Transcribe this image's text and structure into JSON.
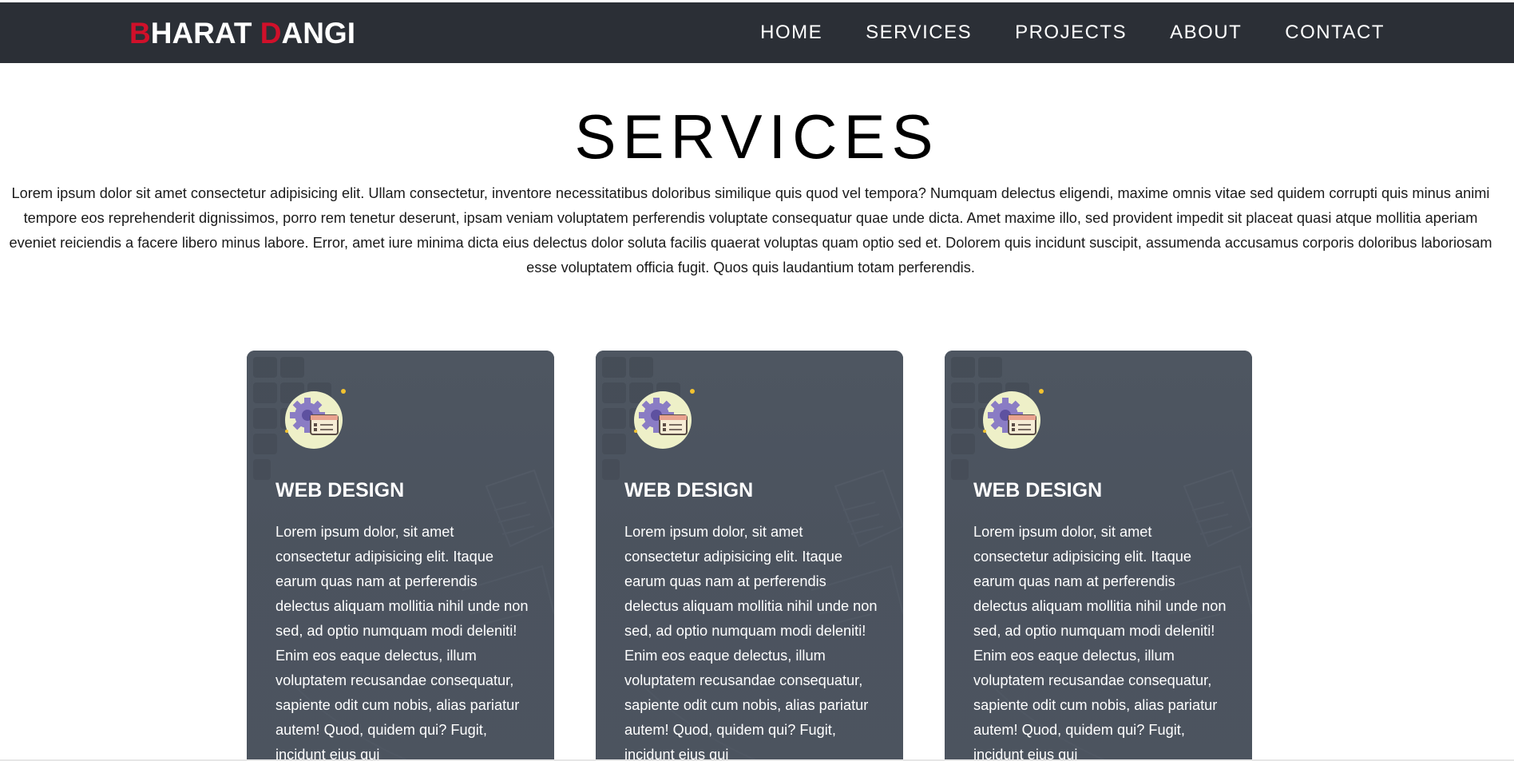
{
  "header": {
    "brand": {
      "first_initial": "B",
      "first_rest": "HARAT ",
      "last_initial": "D",
      "last_rest": "ANGI",
      "accent_color": "#d0102a"
    },
    "nav": [
      {
        "label": "HOME"
      },
      {
        "label": "SERVICES"
      },
      {
        "label": "PROJECTS"
      },
      {
        "label": "ABOUT"
      },
      {
        "label": "CONTACT"
      }
    ],
    "background_color": "#2b2f36"
  },
  "main": {
    "title": "SERVICES",
    "intro": "Lorem ipsum dolor sit amet consectetur adipisicing elit. Ullam consectetur, inventore necessitatibus doloribus similique quis quod vel tempora? Numquam delectus eligendi, maxime omnis vitae sed quidem corrupti quis minus animi tempore eos reprehenderit dignissimos, porro rem tenetur deserunt, ipsam veniam voluptatem perferendis voluptate consequatur quae unde dicta. Amet maxime illo, sed provident impedit sit placeat quasi atque mollitia aperiam eveniet reiciendis a facere libero minus labore. Error, amet iure minima dicta eius delectus dolor soluta facilis quaerat voluptas quam optio sed et. Dolorem quis incidunt suscipit, assumenda accusamus corporis doloribus laboriosam esse voluptatem officia fugit. Quos quis laudantium totam perferendis.",
    "cards": [
      {
        "icon": "settings-gear-window-icon",
        "title": "WEB DESIGN",
        "text": "Lorem ipsum dolor, sit amet consectetur adipisicing elit. Itaque earum quas nam at perferendis delectus aliquam mollitia nihil unde non sed, ad optio numquam modi deleniti! Enim eos eaque delectus, illum voluptatem recusandae consequatur, sapiente odit cum nobis, alias pariatur autem! Quod, quidem qui? Fugit, incidunt eius qui"
      },
      {
        "icon": "settings-gear-window-icon",
        "title": "WEB DESIGN",
        "text": "Lorem ipsum dolor, sit amet consectetur adipisicing elit. Itaque earum quas nam at perferendis delectus aliquam mollitia nihil unde non sed, ad optio numquam modi deleniti! Enim eos eaque delectus, illum voluptatem recusandae consequatur, sapiente odit cum nobis, alias pariatur autem! Quod, quidem qui? Fugit, incidunt eius qui"
      },
      {
        "icon": "settings-gear-window-icon",
        "title": "WEB DESIGN",
        "text": "Lorem ipsum dolor, sit amet consectetur adipisicing elit. Itaque earum quas nam at perferendis delectus aliquam mollitia nihil unde non sed, ad optio numquam modi deleniti! Enim eos eaque delectus, illum voluptatem recusandae consequatur, sapiente odit cum nobis, alias pariatur autem! Quod, quidem qui? Fugit, incidunt eius qui"
      }
    ]
  }
}
